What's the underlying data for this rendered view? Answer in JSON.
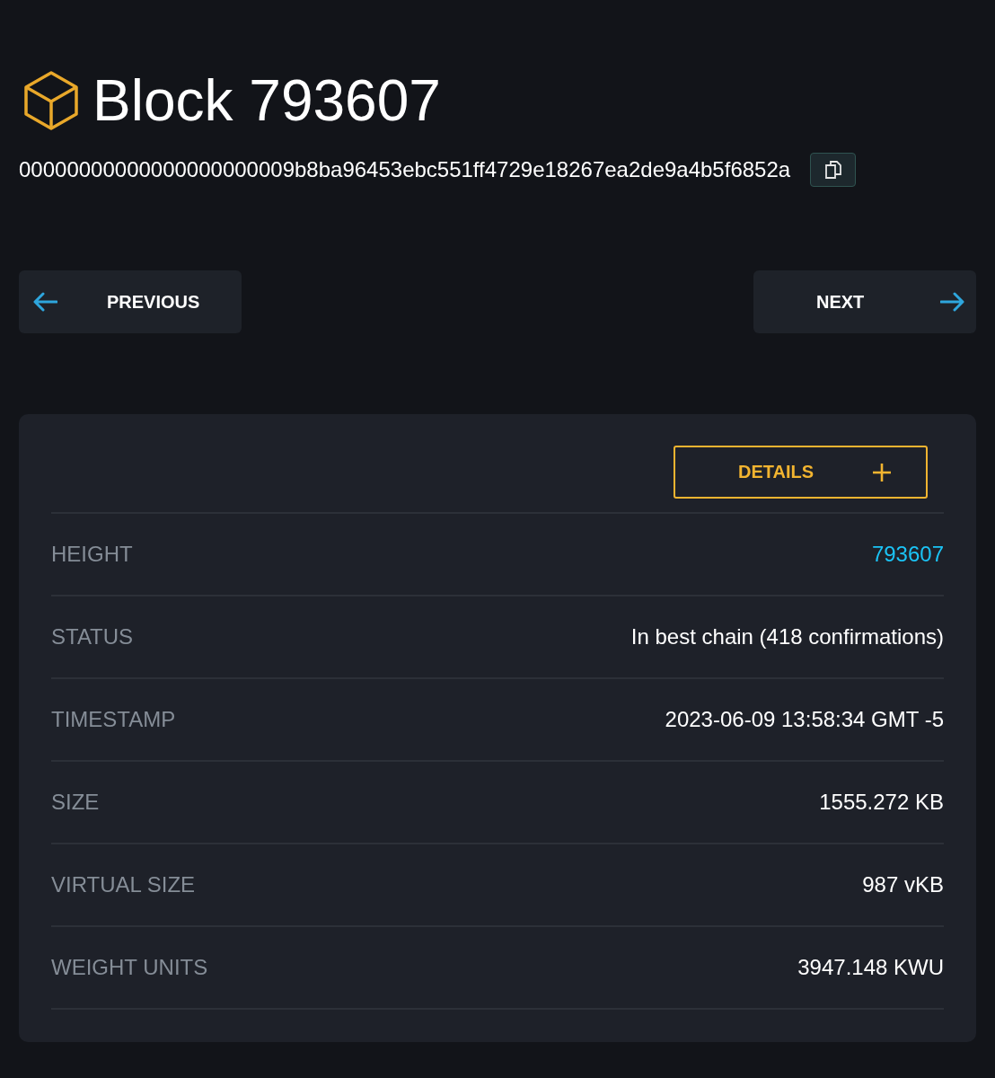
{
  "header": {
    "title": "Block 793607",
    "hash": "00000000000000000000009b8ba96453ebc551ff4729e18267ea2de9a4b5f6852a"
  },
  "navigation": [
    {
      "label": "PREVIOUS",
      "kind": "previous"
    },
    {
      "label": "NEXT",
      "kind": "next"
    }
  ],
  "details_toggle": {
    "label": "DETAILS",
    "expanded": false
  },
  "rows": [
    {
      "label": "HEIGHT",
      "value": "793607",
      "kind": "link"
    },
    {
      "label": "STATUS",
      "value": "In best chain (418 confirmations)",
      "kind": "text"
    },
    {
      "label": "TIMESTAMP",
      "value": "2023-06-09 13:58:34 GMT -5",
      "kind": "text"
    },
    {
      "label": "SIZE",
      "value": "1555.272 KB",
      "kind": "text"
    },
    {
      "label": "VIRTUAL SIZE",
      "value": "987 vKB",
      "kind": "text"
    },
    {
      "label": "WEIGHT UNITS",
      "value": "3947.148 KWU",
      "kind": "text"
    }
  ]
}
